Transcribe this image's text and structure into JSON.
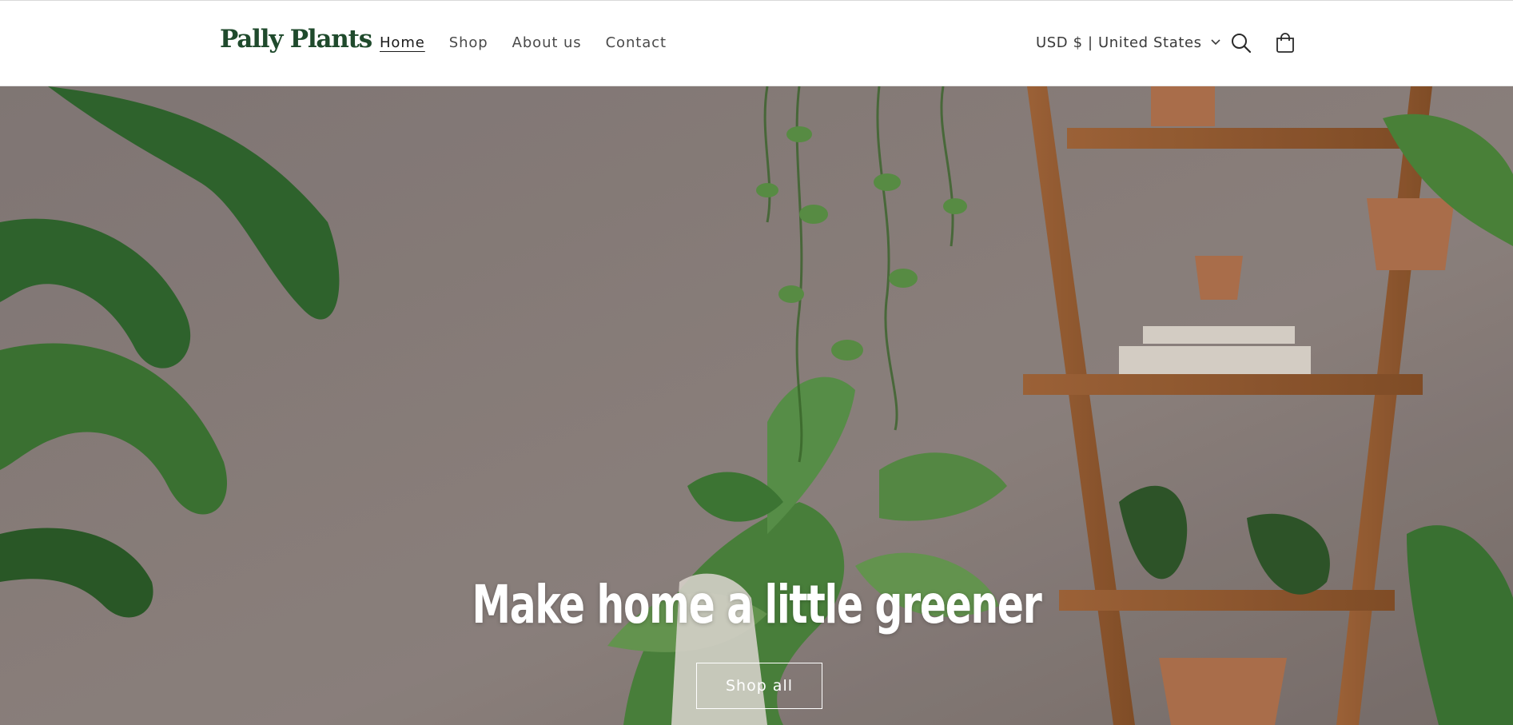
{
  "brand": {
    "name": "Pally Plants",
    "color": "#1f4a2c"
  },
  "nav": {
    "items": [
      {
        "label": "Home",
        "active": true
      },
      {
        "label": "Shop",
        "active": false
      },
      {
        "label": "About us",
        "active": false
      },
      {
        "label": "Contact",
        "active": false
      }
    ]
  },
  "header_actions": {
    "locale": "USD $ | United States",
    "icons": [
      "chevron-down-icon",
      "search-icon",
      "cart-icon"
    ]
  },
  "hero": {
    "heading": "Make home a little greener",
    "button_label": "Shop all",
    "text_color": "#ffffff"
  }
}
